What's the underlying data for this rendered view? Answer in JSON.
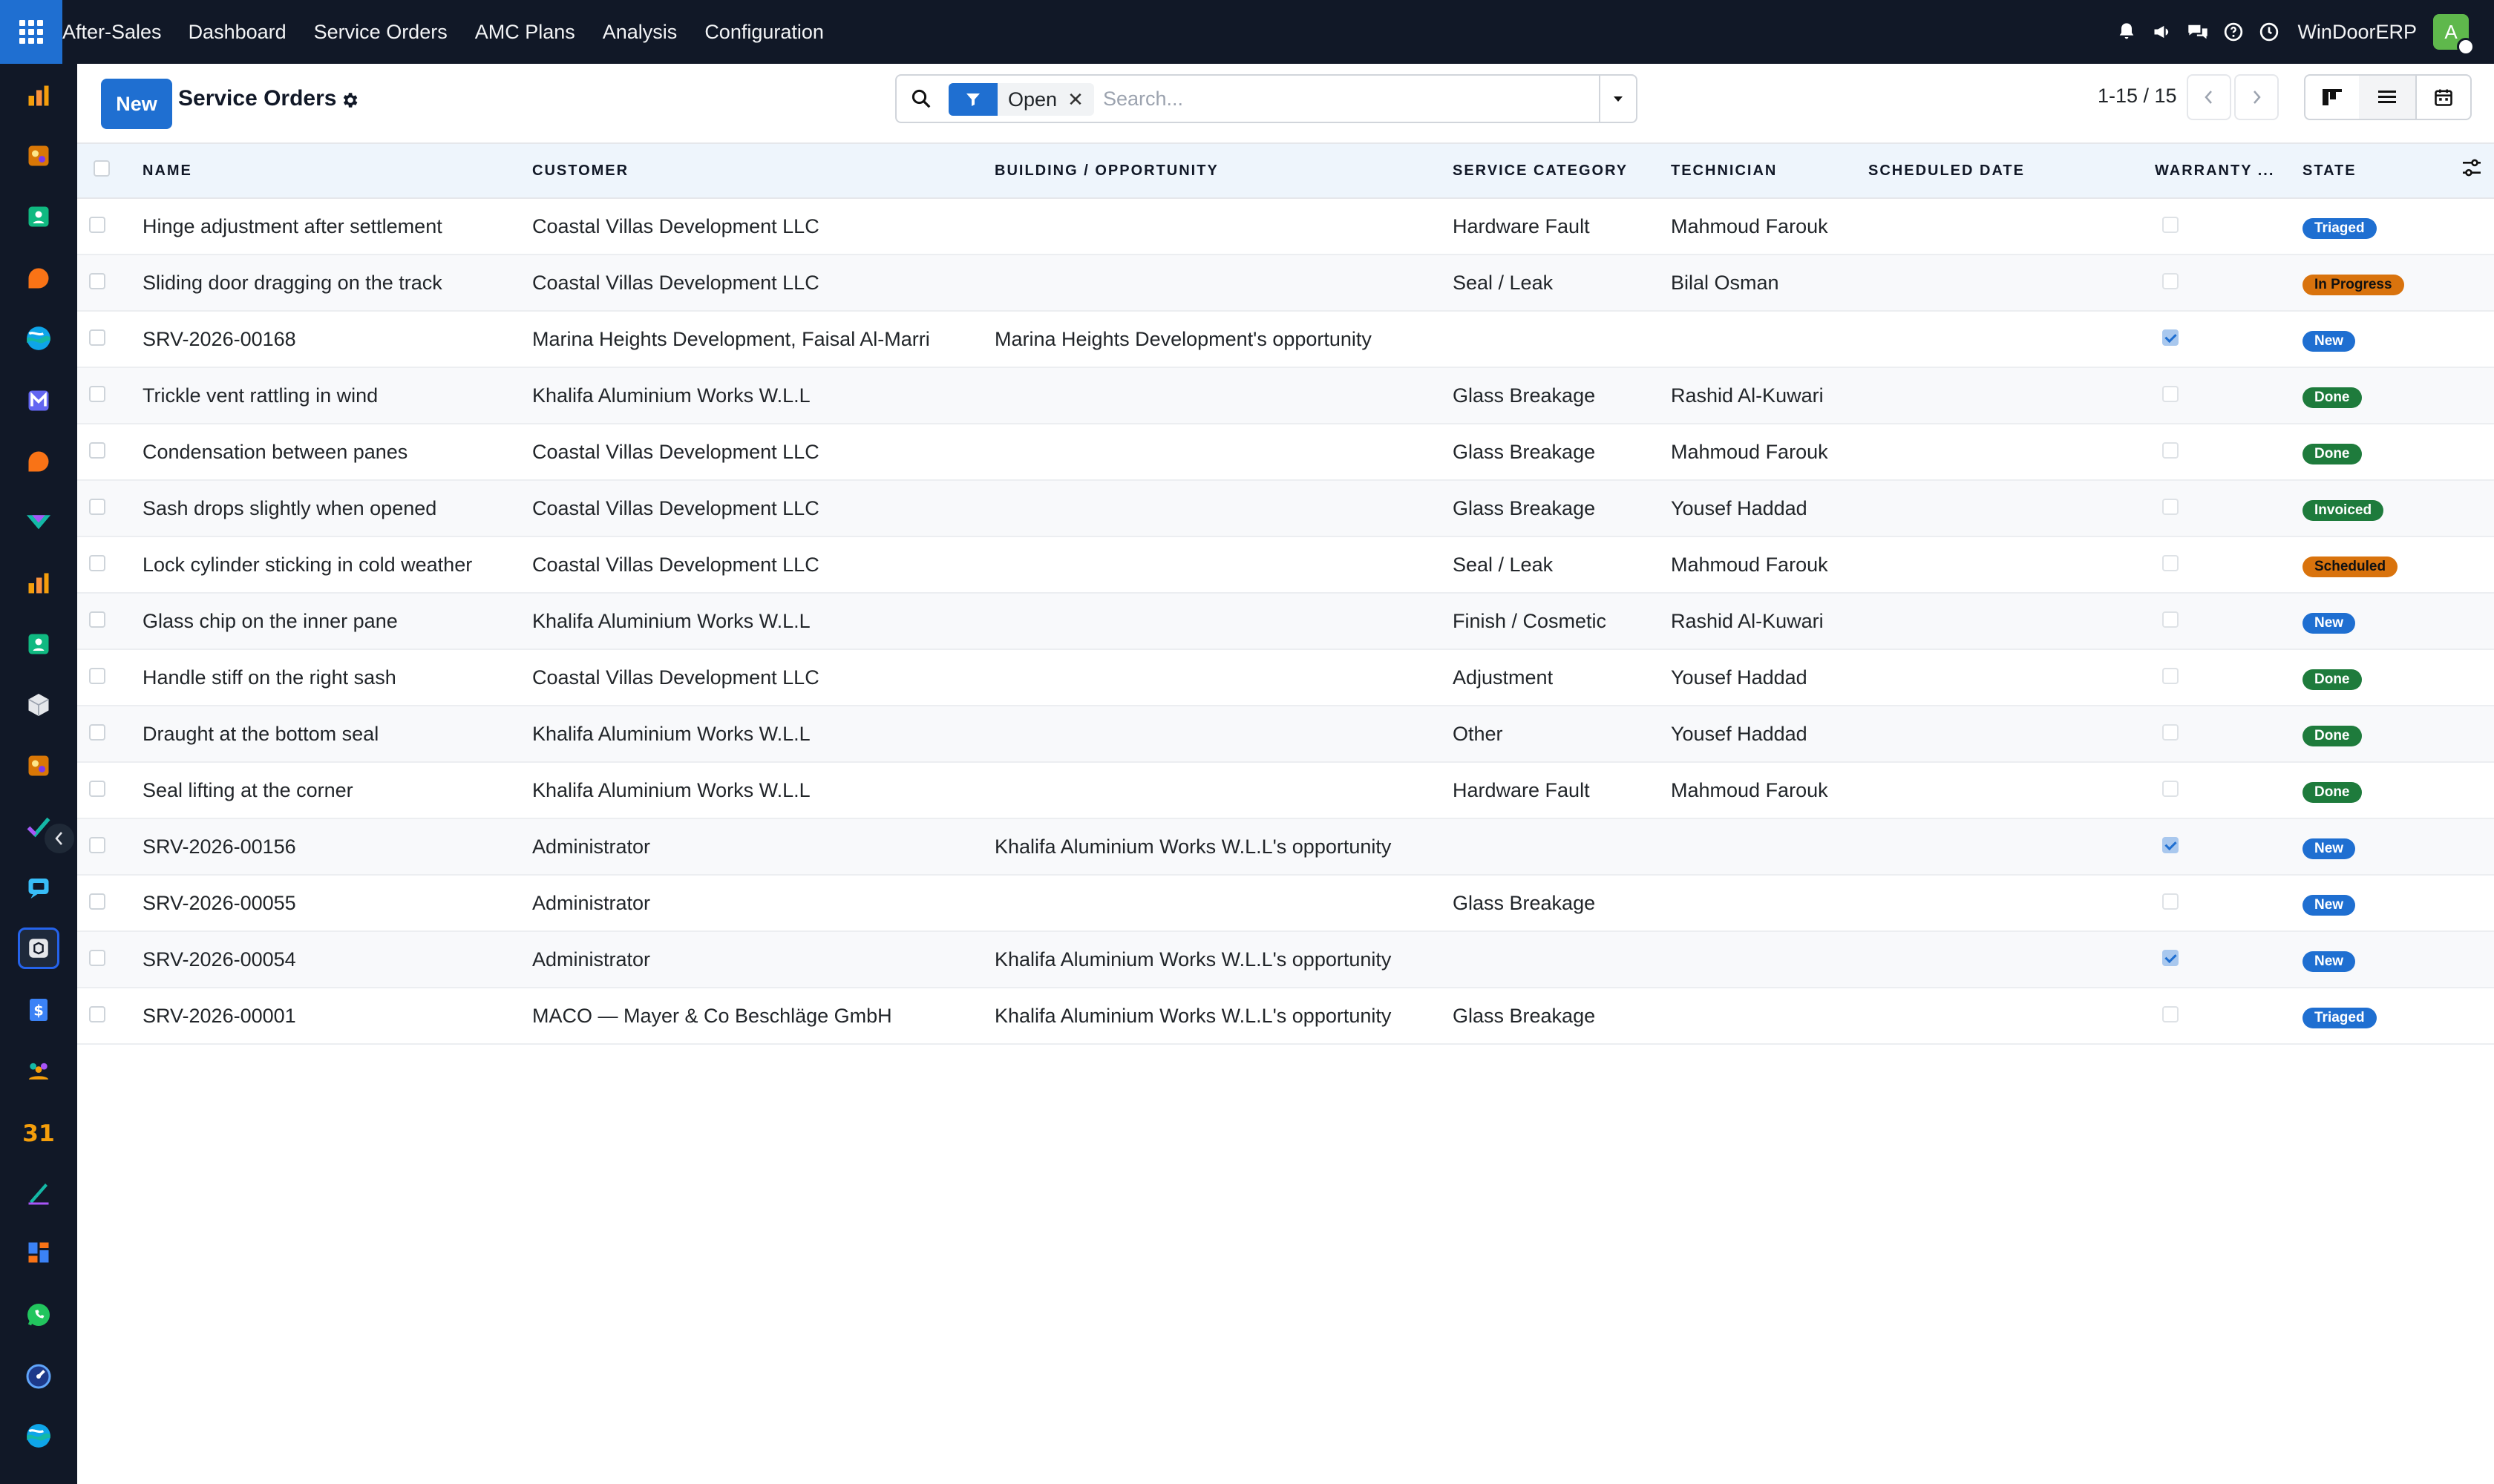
{
  "app": {
    "name": "After-Sales",
    "menu": [
      "Dashboard",
      "Service Orders",
      "AMC Plans",
      "Analysis",
      "Configuration"
    ],
    "company": "WinDoorERP",
    "user_initial": "A"
  },
  "sidebar": {
    "items": [
      {
        "icon": "bar-chart-icon",
        "color": "#f59e0b"
      },
      {
        "icon": "palette-icon",
        "color": "#d97706"
      },
      {
        "icon": "contact-card-icon",
        "color": "#10b981"
      },
      {
        "icon": "chat-bubble-icon",
        "color": "#f97316"
      },
      {
        "icon": "wave-logo-icon",
        "color": "#14b8a6"
      },
      {
        "icon": "mail-m-icon",
        "color": "#6366f1"
      },
      {
        "icon": "chat-bubble-icon",
        "color": "#f97316"
      },
      {
        "icon": "tag-icon",
        "color": "#14b8a6"
      },
      {
        "icon": "bar-chart-icon",
        "color": "#f59e0b"
      },
      {
        "icon": "contact-card-icon",
        "color": "#10b981"
      },
      {
        "icon": "cube-icon",
        "color": "#e5e7eb"
      },
      {
        "icon": "palette-icon",
        "color": "#d97706"
      },
      {
        "icon": "checkmark-icon",
        "color": "#14b8a6"
      },
      {
        "icon": "chat-square-icon",
        "color": "#38bdf8"
      },
      {
        "icon": "after-sales-box-icon",
        "color": "#e5e7eb",
        "active": true
      },
      {
        "icon": "dollar-doc-icon",
        "color": "#3b82f6"
      },
      {
        "icon": "people-icon",
        "color": "#f59e0b"
      },
      {
        "icon": "calendar-31-icon",
        "color": "#f59e0b",
        "text": "31"
      },
      {
        "icon": "pen-sign-icon",
        "color": "#14b8a6"
      },
      {
        "icon": "dashboard-tiles-icon",
        "color": "#3b82f6"
      },
      {
        "icon": "whatsapp-icon",
        "color": "#22c55e"
      },
      {
        "icon": "gauge-icon",
        "color": "#60a5fa"
      },
      {
        "icon": "wave-logo-icon",
        "color": "#14b8a6"
      }
    ]
  },
  "control_panel": {
    "new_label": "New",
    "title": "Service Orders",
    "facet": "Open",
    "search_placeholder": "Search...",
    "pager": "1-15 / 15"
  },
  "table": {
    "columns": [
      "NAME",
      "CUSTOMER",
      "BUILDING / OPPORTUNITY",
      "SERVICE CATEGORY",
      "TECHNICIAN",
      "SCHEDULED DATE",
      "WARRANTY ...",
      "STATE"
    ],
    "rows": [
      {
        "name": "Hinge adjustment after settlement",
        "customer": "Coastal Villas Development LLC",
        "opportunity": "",
        "category": "Hardware Fault",
        "technician": "Mahmoud Farouk",
        "scheduled": "",
        "warranty": false,
        "state": "Triaged"
      },
      {
        "name": "Sliding door dragging on the track",
        "customer": "Coastal Villas Development LLC",
        "opportunity": "",
        "category": "Seal / Leak",
        "technician": "Bilal Osman",
        "scheduled": "",
        "warranty": false,
        "state": "In Progress"
      },
      {
        "name": "SRV-2026-00168",
        "customer": "Marina Heights Development, Faisal Al-Marri",
        "opportunity": "Marina Heights Development's opportunity",
        "category": "",
        "technician": "",
        "scheduled": "",
        "warranty": true,
        "state": "New"
      },
      {
        "name": "Trickle vent rattling in wind",
        "customer": "Khalifa Aluminium Works W.L.L",
        "opportunity": "",
        "category": "Glass Breakage",
        "technician": "Rashid Al-Kuwari",
        "scheduled": "",
        "warranty": false,
        "state": "Done"
      },
      {
        "name": "Condensation between panes",
        "customer": "Coastal Villas Development LLC",
        "opportunity": "",
        "category": "Glass Breakage",
        "technician": "Mahmoud Farouk",
        "scheduled": "",
        "warranty": false,
        "state": "Done"
      },
      {
        "name": "Sash drops slightly when opened",
        "customer": "Coastal Villas Development LLC",
        "opportunity": "",
        "category": "Glass Breakage",
        "technician": "Yousef Haddad",
        "scheduled": "",
        "warranty": false,
        "state": "Invoiced"
      },
      {
        "name": "Lock cylinder sticking in cold weather",
        "customer": "Coastal Villas Development LLC",
        "opportunity": "",
        "category": "Seal / Leak",
        "technician": "Mahmoud Farouk",
        "scheduled": "",
        "warranty": false,
        "state": "Scheduled"
      },
      {
        "name": "Glass chip on the inner pane",
        "customer": "Khalifa Aluminium Works W.L.L",
        "opportunity": "",
        "category": "Finish / Cosmetic",
        "technician": "Rashid Al-Kuwari",
        "scheduled": "",
        "warranty": false,
        "state": "New"
      },
      {
        "name": "Handle stiff on the right sash",
        "customer": "Coastal Villas Development LLC",
        "opportunity": "",
        "category": "Adjustment",
        "technician": "Yousef Haddad",
        "scheduled": "",
        "warranty": false,
        "state": "Done"
      },
      {
        "name": "Draught at the bottom seal",
        "customer": "Khalifa Aluminium Works W.L.L",
        "opportunity": "",
        "category": "Other",
        "technician": "Yousef Haddad",
        "scheduled": "",
        "warranty": false,
        "state": "Done"
      },
      {
        "name": "Seal lifting at the corner",
        "customer": "Khalifa Aluminium Works W.L.L",
        "opportunity": "",
        "category": "Hardware Fault",
        "technician": "Mahmoud Farouk",
        "scheduled": "",
        "warranty": false,
        "state": "Done"
      },
      {
        "name": "SRV-2026-00156",
        "customer": "Administrator",
        "opportunity": "Khalifa Aluminium Works W.L.L's opportunity",
        "category": "",
        "technician": "",
        "scheduled": "",
        "warranty": true,
        "state": "New"
      },
      {
        "name": "SRV-2026-00055",
        "customer": "Administrator",
        "opportunity": "",
        "category": "Glass Breakage",
        "technician": "",
        "scheduled": "",
        "warranty": false,
        "state": "New"
      },
      {
        "name": "SRV-2026-00054",
        "customer": "Administrator",
        "opportunity": "Khalifa Aluminium Works W.L.L's opportunity",
        "category": "",
        "technician": "",
        "scheduled": "",
        "warranty": true,
        "state": "New"
      },
      {
        "name": "SRV-2026-00001",
        "customer": "MACO — Mayer & Co Beschläge GmbH",
        "opportunity": "Khalifa Aluminium Works W.L.L's opportunity",
        "category": "Glass Breakage",
        "technician": "",
        "scheduled": "",
        "warranty": false,
        "state": "Triaged"
      }
    ]
  },
  "colors": {
    "topbar": "#111827",
    "primary": "#1f6fd1",
    "done": "#1e7b3c",
    "warning": "#d9730d"
  }
}
